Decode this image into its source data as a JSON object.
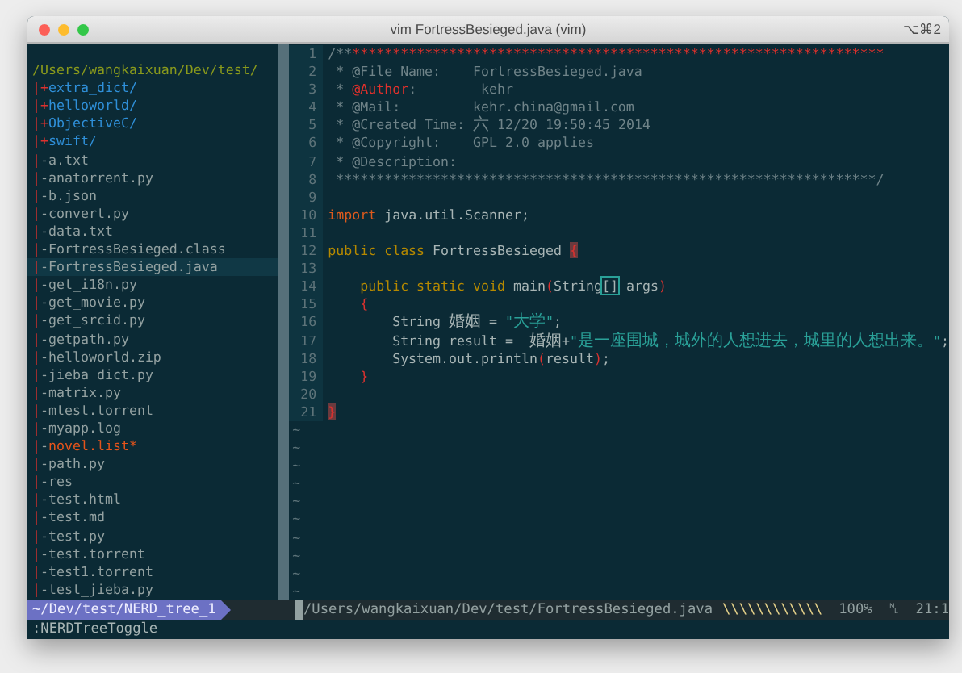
{
  "window": {
    "title": "vim FortressBesieged.java (vim)",
    "shortcut": "⌥⌘2"
  },
  "tree": {
    "root": "/Users/wangkaixuan/Dev/test/",
    "items": [
      {
        "prefix": "|+",
        "name": "extra_dict/",
        "kind": "dir",
        "selected": false
      },
      {
        "prefix": "|+",
        "name": "helloworld/",
        "kind": "dir",
        "selected": false
      },
      {
        "prefix": "|+",
        "name": "ObjectiveC/",
        "kind": "dir",
        "selected": false
      },
      {
        "prefix": "|+",
        "name": "swift/",
        "kind": "dir",
        "selected": false
      },
      {
        "prefix": "|-",
        "name": "a.txt",
        "kind": "file",
        "selected": false
      },
      {
        "prefix": "|-",
        "name": "anatorrent.py",
        "kind": "file",
        "selected": false
      },
      {
        "prefix": "|-",
        "name": "b.json",
        "kind": "file",
        "selected": false
      },
      {
        "prefix": "|-",
        "name": "convert.py",
        "kind": "file",
        "selected": false
      },
      {
        "prefix": "|-",
        "name": "data.txt",
        "kind": "file",
        "selected": false
      },
      {
        "prefix": "|-",
        "name": "FortressBesieged.class",
        "kind": "file",
        "selected": false
      },
      {
        "prefix": "|-",
        "name": "FortressBesieged.java",
        "kind": "file",
        "selected": true
      },
      {
        "prefix": "|-",
        "name": "get_i18n.py",
        "kind": "file",
        "selected": false
      },
      {
        "prefix": "|-",
        "name": "get_movie.py",
        "kind": "file",
        "selected": false
      },
      {
        "prefix": "|-",
        "name": "get_srcid.py",
        "kind": "file",
        "selected": false
      },
      {
        "prefix": "|-",
        "name": "getpath.py",
        "kind": "file",
        "selected": false
      },
      {
        "prefix": "|-",
        "name": "helloworld.zip",
        "kind": "file",
        "selected": false
      },
      {
        "prefix": "|-",
        "name": "jieba_dict.py",
        "kind": "file",
        "selected": false
      },
      {
        "prefix": "|-",
        "name": "matrix.py",
        "kind": "file",
        "selected": false
      },
      {
        "prefix": "|-",
        "name": "mtest.torrent",
        "kind": "file",
        "selected": false
      },
      {
        "prefix": "|-",
        "name": "myapp.log",
        "kind": "file",
        "selected": false
      },
      {
        "prefix": "|-",
        "name": "novel.list*",
        "kind": "modified",
        "selected": false
      },
      {
        "prefix": "|-",
        "name": "path.py",
        "kind": "file",
        "selected": false
      },
      {
        "prefix": "|-",
        "name": "res",
        "kind": "file",
        "selected": false
      },
      {
        "prefix": "|-",
        "name": "test.html",
        "kind": "file",
        "selected": false
      },
      {
        "prefix": "|-",
        "name": "test.md",
        "kind": "file",
        "selected": false
      },
      {
        "prefix": "|-",
        "name": "test.py",
        "kind": "file",
        "selected": false
      },
      {
        "prefix": "|-",
        "name": "test.torrent",
        "kind": "file",
        "selected": false
      },
      {
        "prefix": "|-",
        "name": "test1.torrent",
        "kind": "file",
        "selected": false
      },
      {
        "prefix": "|-",
        "name": "test_jieba.py",
        "kind": "file",
        "selected": false
      }
    ]
  },
  "editor": {
    "lines": [
      {
        "number": "1",
        "segments": [
          {
            "kind": "comment",
            "text": "/**"
          },
          {
            "kind": "tag",
            "text": "******************************************************************"
          }
        ]
      },
      {
        "number": "2",
        "segments": [
          {
            "kind": "comment",
            "text": " * @File Name:    FortressBesieged.java"
          }
        ]
      },
      {
        "number": "3",
        "segments": [
          {
            "kind": "comment",
            "text": " * "
          },
          {
            "kind": "tag",
            "text": "@Author"
          },
          {
            "kind": "comment",
            "text": ":        kehr"
          }
        ]
      },
      {
        "number": "4",
        "segments": [
          {
            "kind": "comment",
            "text": " * @Mail:         kehr.china@gmail.com"
          }
        ]
      },
      {
        "number": "5",
        "segments": [
          {
            "kind": "comment",
            "text": " * @Created Time: 六 12/20 19:50:45 2014"
          }
        ]
      },
      {
        "number": "6",
        "segments": [
          {
            "kind": "comment",
            "text": " * @Copyright:    GPL 2.0 applies"
          }
        ]
      },
      {
        "number": "7",
        "segments": [
          {
            "kind": "comment",
            "text": " * @Description:"
          }
        ]
      },
      {
        "number": "8",
        "segments": [
          {
            "kind": "comment",
            "text": " *******************************************************************/"
          }
        ]
      },
      {
        "number": "9"
      },
      {
        "number": "10",
        "segments": [
          {
            "kind": "import",
            "text": "import"
          },
          {
            "kind": "plain",
            "text": " java.util.Scanner;"
          }
        ]
      },
      {
        "number": "11"
      },
      {
        "number": "12",
        "segments": [
          {
            "kind": "keyword",
            "text": "public class"
          },
          {
            "kind": "plain",
            "text": " FortressBesieged "
          },
          {
            "kind": "cursor",
            "text": "{"
          }
        ]
      },
      {
        "number": "13"
      },
      {
        "number": "14",
        "segments": [
          {
            "kind": "keyword",
            "text": "    public static void"
          },
          {
            "kind": "plain",
            "text": " main"
          },
          {
            "kind": "brace",
            "text": "("
          },
          {
            "kind": "plain",
            "text": "String"
          },
          {
            "kind": "match",
            "text": "[]"
          },
          {
            "kind": "plain",
            "text": " args"
          },
          {
            "kind": "brace",
            "text": ")"
          }
        ]
      },
      {
        "number": "15",
        "segments": [
          {
            "kind": "brace",
            "text": "    {"
          }
        ]
      },
      {
        "number": "16",
        "segments": [
          {
            "kind": "plain",
            "text": "        String 婚姻 = "
          },
          {
            "kind": "string",
            "text": "\"大学\""
          },
          {
            "kind": "plain",
            "text": ";"
          }
        ]
      },
      {
        "number": "17",
        "segments": [
          {
            "kind": "plain",
            "text": "        String result =  婚姻+"
          },
          {
            "kind": "string",
            "text": "\"是一座围城，城外的人想进去，城里的人想出来。\""
          },
          {
            "kind": "plain",
            "text": ";"
          }
        ]
      },
      {
        "number": "18",
        "segments": [
          {
            "kind": "plain",
            "text": "        System.out.println"
          },
          {
            "kind": "brace",
            "text": "("
          },
          {
            "kind": "plain",
            "text": "result"
          },
          {
            "kind": "brace",
            "text": ")"
          },
          {
            "kind": "plain",
            "text": ";"
          }
        ]
      },
      {
        "number": "19",
        "segments": [
          {
            "kind": "brace",
            "text": "    }"
          }
        ]
      },
      {
        "number": "20"
      },
      {
        "number": "21",
        "segments": [
          {
            "kind": "cursor",
            "text": "}"
          }
        ]
      }
    ],
    "empty_lines": [
      "~",
      "~",
      "~",
      "~",
      "~",
      "~",
      "~",
      "~",
      "~",
      "~"
    ]
  },
  "tree_status": {
    "label": "~/Dev/test/NERD_tree_1"
  },
  "editor_status": {
    "path": "/Users/wangkaixuan/Dev/test/FortressBesieged.java",
    "hatch": "\\\\\\\\\\\\\\\\\\\\\\\\",
    "percent": "100%",
    "symbol": "␤",
    "position": "21:1"
  },
  "command_line": ":NERDTreeToggle"
}
